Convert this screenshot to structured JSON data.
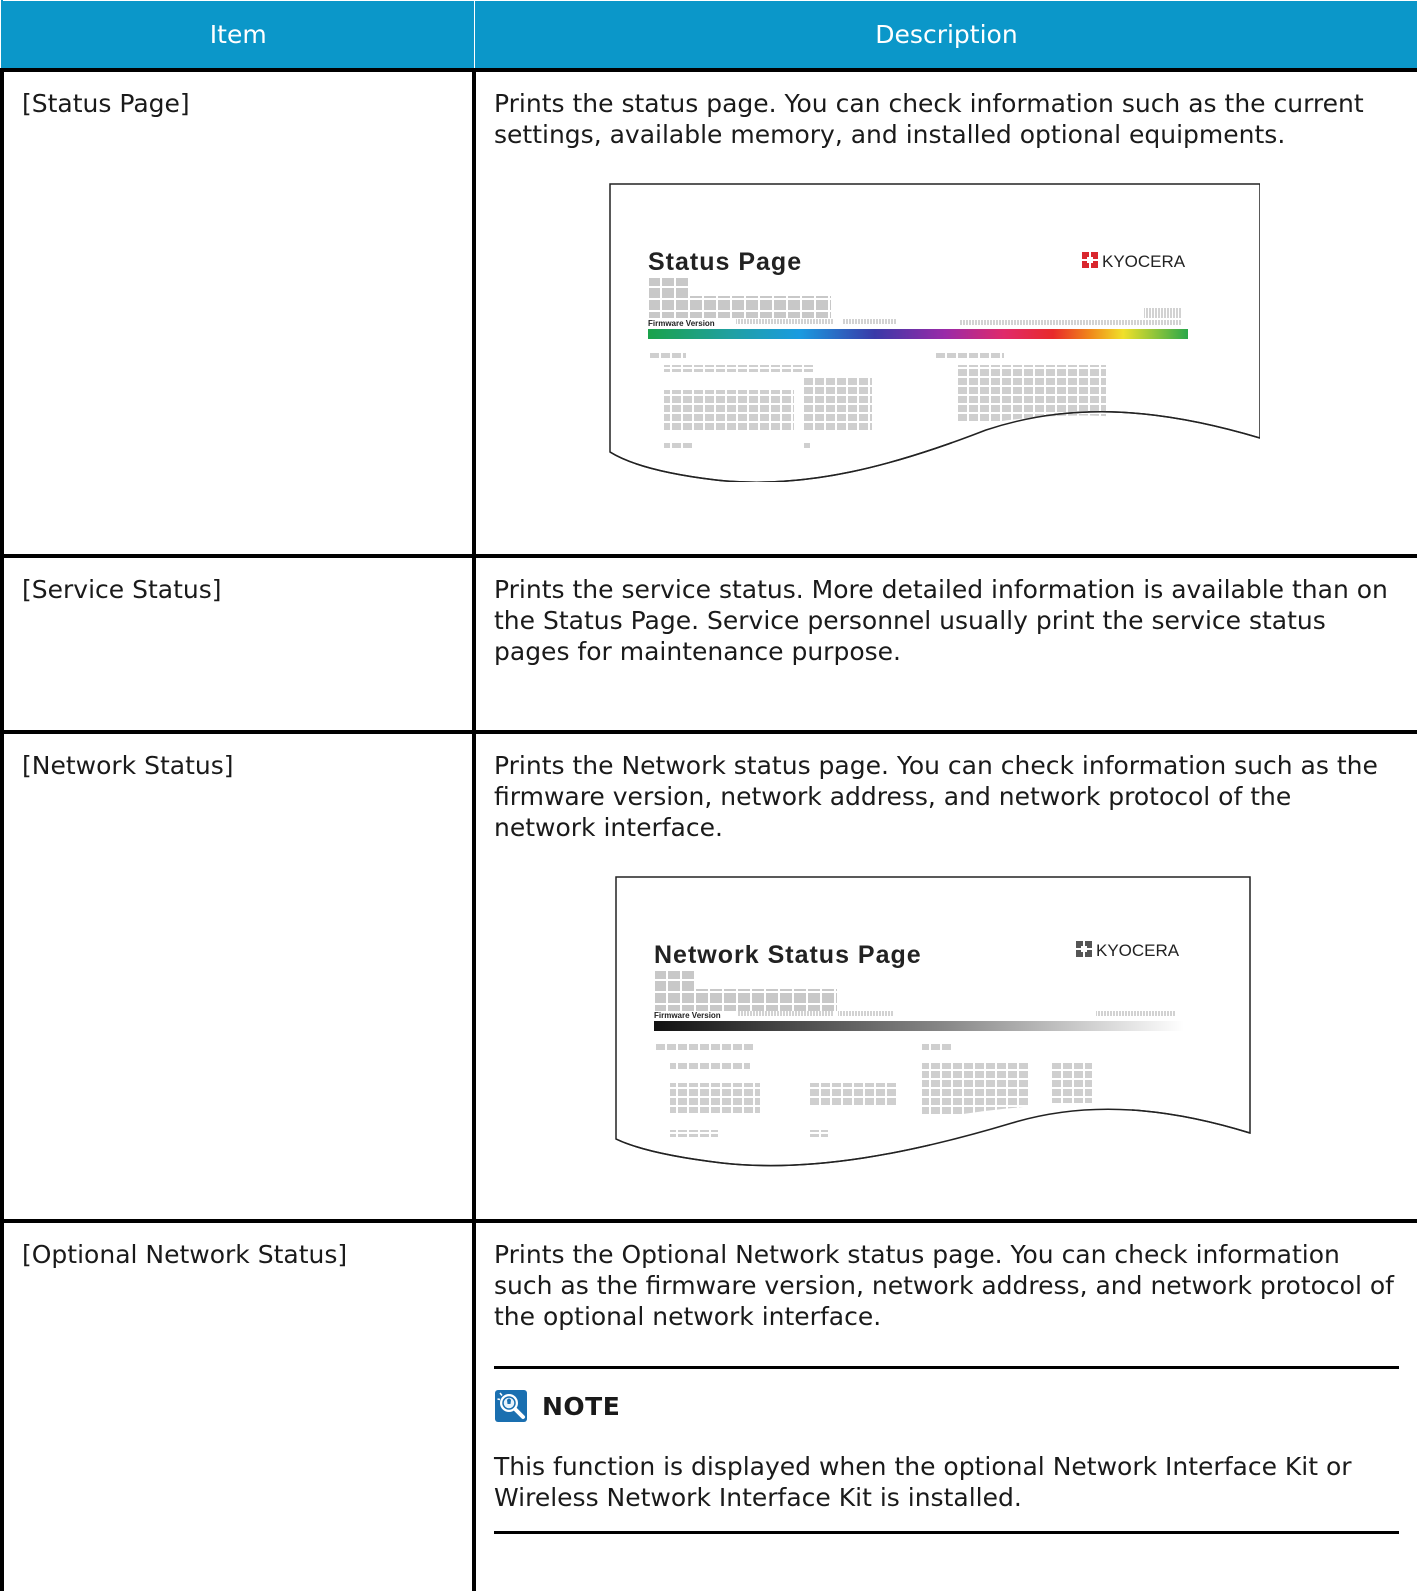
{
  "table": {
    "header": {
      "item": "Item",
      "description": "Description"
    },
    "rows": [
      {
        "item": "[Status Page]",
        "description": "Prints the status page. You can check information such as the current settings, available memory, and installed optional equipments.",
        "illustration": {
          "title": "Status Page",
          "brand": "KYOCERA",
          "firmware_label": "Firmware Version"
        }
      },
      {
        "item": "[Service Status]",
        "description": "Prints the service status. More detailed information is available than on the Status Page. Service personnel usually print the service status pages for maintenance purpose."
      },
      {
        "item": "[Network Status]",
        "description": "Prints the Network status page. You can check information such as the firmware version, network address, and network protocol of the network interface.",
        "illustration": {
          "title": "Network Status Page",
          "brand": "KYOCERA",
          "firmware_label": "Firmware Version"
        }
      },
      {
        "item": "[Optional Network Status]",
        "description": "Prints the Optional Network status page. You can check information such as the firmware version, network address, and network protocol of the optional network interface.",
        "note": {
          "title": "NOTE",
          "icon": "lightbulb-magnifier-icon",
          "text": "This function is displayed when the optional Network Interface Kit or Wireless Network Interface Kit is installed."
        }
      }
    ]
  },
  "colors": {
    "header_bg": "#0b97c9",
    "header_text": "#ffffff",
    "brand_red": "#d9262e",
    "note_icon": "#1a6fb0"
  }
}
